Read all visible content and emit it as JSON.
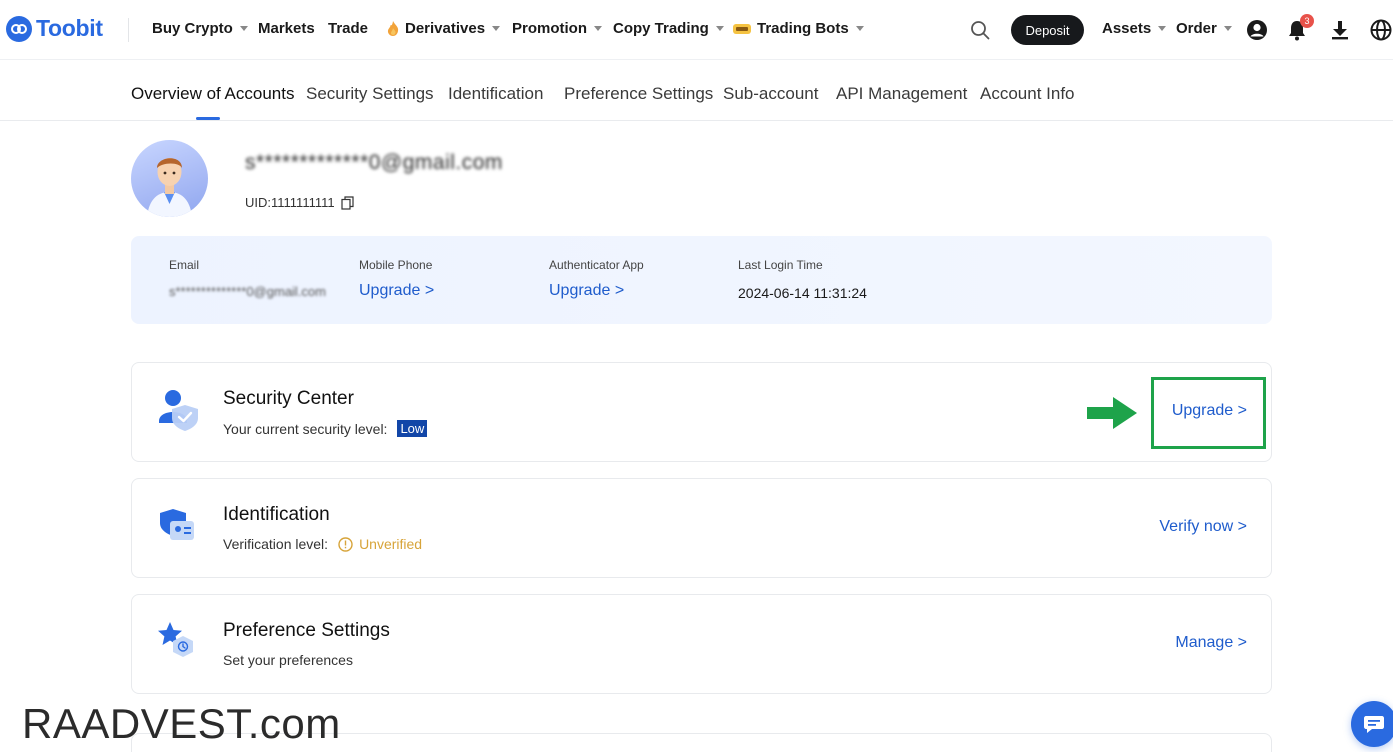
{
  "brand": {
    "name": "Toobit",
    "accent": "#2a6ae0"
  },
  "nav": {
    "items": [
      {
        "label": "Buy Crypto",
        "dropdown": true
      },
      {
        "label": "Markets",
        "dropdown": false
      },
      {
        "label": "Trade",
        "dropdown": false
      },
      {
        "label": "Derivatives",
        "dropdown": true,
        "icon": "flame-icon"
      },
      {
        "label": "Promotion",
        "dropdown": true
      },
      {
        "label": "Copy Trading",
        "dropdown": true
      },
      {
        "label": "Trading Bots",
        "dropdown": true,
        "icon": "bot-icon"
      }
    ],
    "deposit_label": "Deposit",
    "assets_label": "Assets",
    "order_label": "Order",
    "notification_count": "3",
    "icons": [
      "search-icon",
      "user-icon",
      "bell-icon",
      "download-icon",
      "globe-icon"
    ]
  },
  "tabs": [
    {
      "label": "Overview of Accounts",
      "active": true
    },
    {
      "label": "Security Settings",
      "active": false
    },
    {
      "label": "Identification",
      "active": false
    },
    {
      "label": "Preference Settings",
      "active": false
    },
    {
      "label": "Sub-account",
      "active": false
    },
    {
      "label": "API Management",
      "active": false
    },
    {
      "label": "Account Info",
      "active": false
    }
  ],
  "profile": {
    "email_masked": "s*************0@gmail.com",
    "uid_label": "UID:1111111111"
  },
  "info": {
    "email_label": "Email",
    "email_value": "s**************0@gmail.com",
    "mobile_label": "Mobile Phone",
    "mobile_value": "Upgrade >",
    "auth_label": "Authenticator App",
    "auth_value": "Upgrade >",
    "login_label": "Last Login Time",
    "login_value": "2024-06-14 11:31:24"
  },
  "cards": {
    "security": {
      "title": "Security Center",
      "sub_label": "Your current security level:",
      "level": "Low",
      "action": "Upgrade >"
    },
    "identification": {
      "title": "Identification",
      "sub_label": "Verification level:",
      "status": "Unverified",
      "action": "Verify now >"
    },
    "preference": {
      "title": "Preference Settings",
      "sub_label": "Set your preferences",
      "action": "Manage >"
    }
  },
  "colors": {
    "link": "#1f5ccc",
    "low_badge": "#1246a8",
    "warning": "#d7a43a",
    "highlight": "#1ea34a"
  },
  "watermark": "RAADVEST.com"
}
